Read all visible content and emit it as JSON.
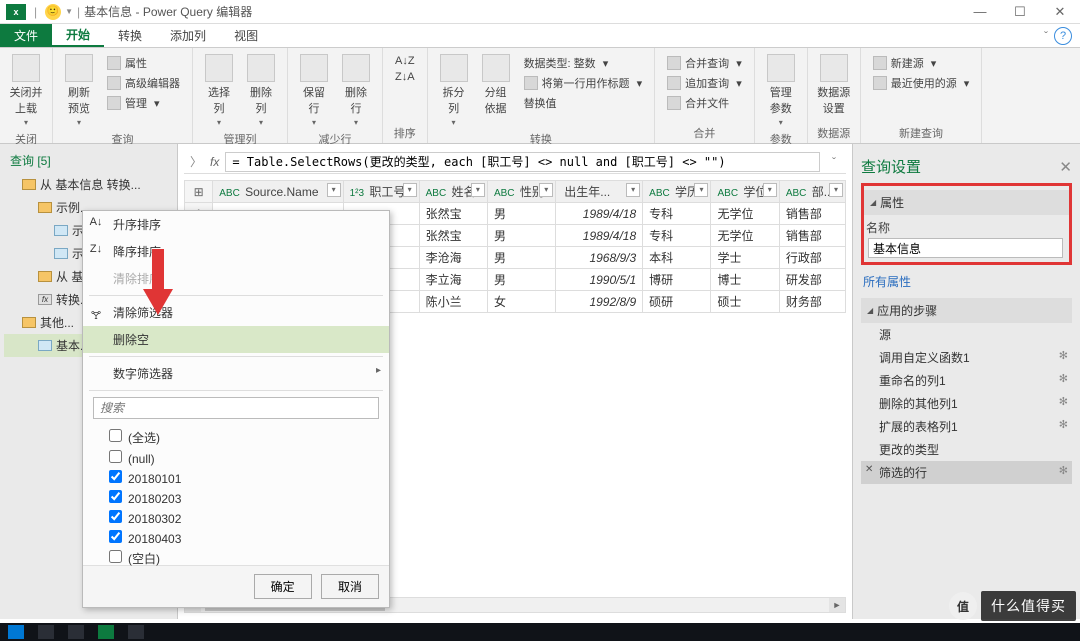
{
  "titlebar": {
    "app_icon": "x",
    "title_doc": "基本信息",
    "title_app": "Power Query 编辑器",
    "sep": "|"
  },
  "menu": {
    "file": "文件",
    "tabs": [
      "开始",
      "转换",
      "添加列",
      "视图"
    ]
  },
  "ribbon": {
    "close": {
      "btn": "关闭并\n上载",
      "group": "关闭"
    },
    "query": {
      "refresh": "刷新\n预览",
      "props": "属性",
      "adv": "高级编辑器",
      "manage": "管理",
      "group": "查询"
    },
    "cols": {
      "choose": "选择\n列",
      "remove": "删除\n列",
      "group": "管理列"
    },
    "rows": {
      "keep": "保留\n行",
      "remove": "删除\n行",
      "group": "减少行"
    },
    "sort": {
      "group": "排序"
    },
    "split": {
      "split": "拆分\n列",
      "groupby": "分组\n依据",
      "group": "排序"
    },
    "transform": {
      "dtype": "数据类型: 整数",
      "firstrow": "将第一行用作标题",
      "replace": "替换值",
      "group": "转换"
    },
    "combine": {
      "merge": "合并查询",
      "append": "追加查询",
      "files": "合并文件",
      "group": "合并"
    },
    "params": {
      "btn": "管理\n参数",
      "group": "参数"
    },
    "datasource": {
      "btn": "数据源\n设置",
      "group": "数据源"
    },
    "newquery": {
      "new": "新建源",
      "recent": "最近使用的源",
      "group": "新建查询"
    }
  },
  "left": {
    "header": "查询 [5]",
    "items": [
      {
        "lvl": 1,
        "icon": "f",
        "label": "从 基本信息 转换..."
      },
      {
        "lvl": 2,
        "icon": "f",
        "label": "示例..."
      },
      {
        "lvl": 3,
        "icon": "t",
        "label": "示..."
      },
      {
        "lvl": 3,
        "icon": "t",
        "label": "示..."
      },
      {
        "lvl": 2,
        "icon": "f",
        "label": "从 基..."
      },
      {
        "lvl": 2,
        "icon": "fx",
        "label": "转换..."
      },
      {
        "lvl": 1,
        "icon": "f",
        "label": "其他..."
      },
      {
        "lvl": 2,
        "icon": "t",
        "label": "基本..."
      }
    ]
  },
  "formula": "= Table.SelectRows(更改的类型, each [职工号] <> null and [职工号] <> \"\")",
  "columns": [
    {
      "type": "ABC",
      "name": "Source.Name"
    },
    {
      "type": "1²3",
      "name": "职工号"
    },
    {
      "type": "ABC",
      "name": "姓名"
    },
    {
      "type": "ABC",
      "name": "性别"
    },
    {
      "type": "",
      "name": "出生年..."
    },
    {
      "type": "ABC",
      "name": "学历"
    },
    {
      "type": "ABC",
      "name": "学位"
    },
    {
      "type": "ABC",
      "name": "部..."
    }
  ],
  "rows": [
    [
      "张然宝",
      "男",
      "1989/4/18",
      "专科",
      "无学位",
      "销售部"
    ],
    [
      "张然宝",
      "男",
      "1989/4/18",
      "专科",
      "无学位",
      "销售部"
    ],
    [
      "李沧海",
      "男",
      "1968/9/3",
      "本科",
      "学士",
      "行政部"
    ],
    [
      "李立海",
      "男",
      "1990/5/1",
      "博研",
      "博士",
      "研发部"
    ],
    [
      "陈小兰",
      "女",
      "1992/8/9",
      "硕研",
      "硕士",
      "财务部"
    ]
  ],
  "right": {
    "title": "查询设置",
    "props_section": "属性",
    "name_label": "名称",
    "name_value": "基本信息",
    "all_props": "所有属性",
    "steps_section": "应用的步骤",
    "steps": [
      "源",
      "调用自定义函数1",
      "重命名的列1",
      "删除的其他列1",
      "扩展的表格列1",
      "更改的类型",
      "筛选的行"
    ]
  },
  "menu_ctx": {
    "sort_asc": "升序排序",
    "sort_desc": "降序排序",
    "clear_sort": "清除排序",
    "clear_filter": "清除筛选器",
    "remove_empty": "删除空",
    "number_filter": "数字筛选器",
    "search_placeholder": "搜索",
    "opts": [
      "(全选)",
      "(null)",
      "20180101",
      "20180203",
      "20180302",
      "20180403",
      "(空白)"
    ],
    "checked": [
      false,
      false,
      true,
      true,
      true,
      true,
      false
    ],
    "ok": "确定",
    "cancel": "取消"
  },
  "watermark": {
    "badge": "值",
    "text": "什么值得买"
  }
}
